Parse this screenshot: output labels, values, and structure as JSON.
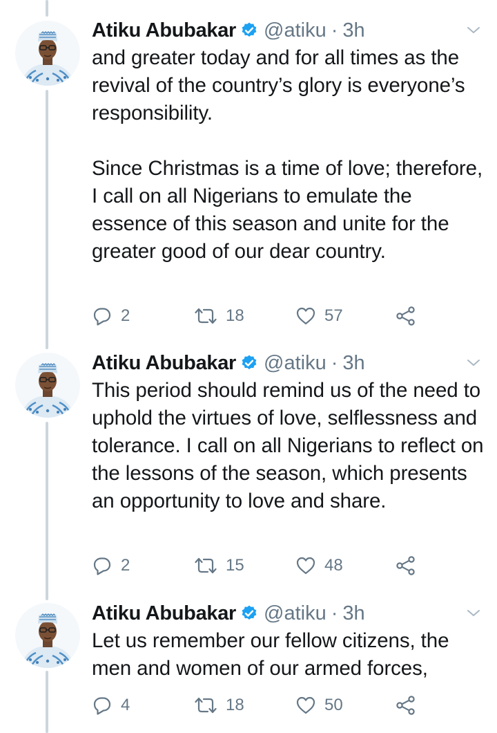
{
  "tweets": [
    {
      "author": {
        "name": "Atiku Abubakar",
        "handle": "@atiku",
        "separator": "·",
        "time": "3h"
      },
      "paragraphs": [
        "and greater today and for all times as the revival of the country’s glory is everyone’s responsibility.",
        "Since Christmas is a time of love; therefore, I call on all Nigerians to emulate the essence of this season and unite for the greater good of our dear country."
      ],
      "replies": "2",
      "retweets": "18",
      "likes": "57"
    },
    {
      "author": {
        "name": "Atiku Abubakar",
        "handle": "@atiku",
        "separator": "·",
        "time": "3h"
      },
      "paragraphs": [
        "This period should remind us of the need to uphold the virtues of love, selflessness and tolerance. I call on all Nigerians to reflect on the lessons of the season, which presents an opportunity to love and share."
      ],
      "replies": "2",
      "retweets": "15",
      "likes": "48"
    },
    {
      "author": {
        "name": "Atiku Abubakar",
        "handle": "@atiku",
        "separator": "·",
        "time": "3h"
      },
      "paragraphs": [
        "Let us remember our fellow citizens, the men and women of our armed forces,"
      ],
      "replies": "4",
      "retweets": "18",
      "likes": "50"
    }
  ],
  "icons": {
    "verified": "verified-badge-icon",
    "caret": "chevron-down-icon",
    "reply": "reply-icon",
    "retweet": "retweet-icon",
    "like": "heart-icon",
    "share": "share-icon"
  },
  "colors": {
    "text": "#14171a",
    "secondary": "#657786",
    "verified": "#1da1f2",
    "thread_line": "#ccd6dd",
    "caret": "#aab8c2"
  }
}
